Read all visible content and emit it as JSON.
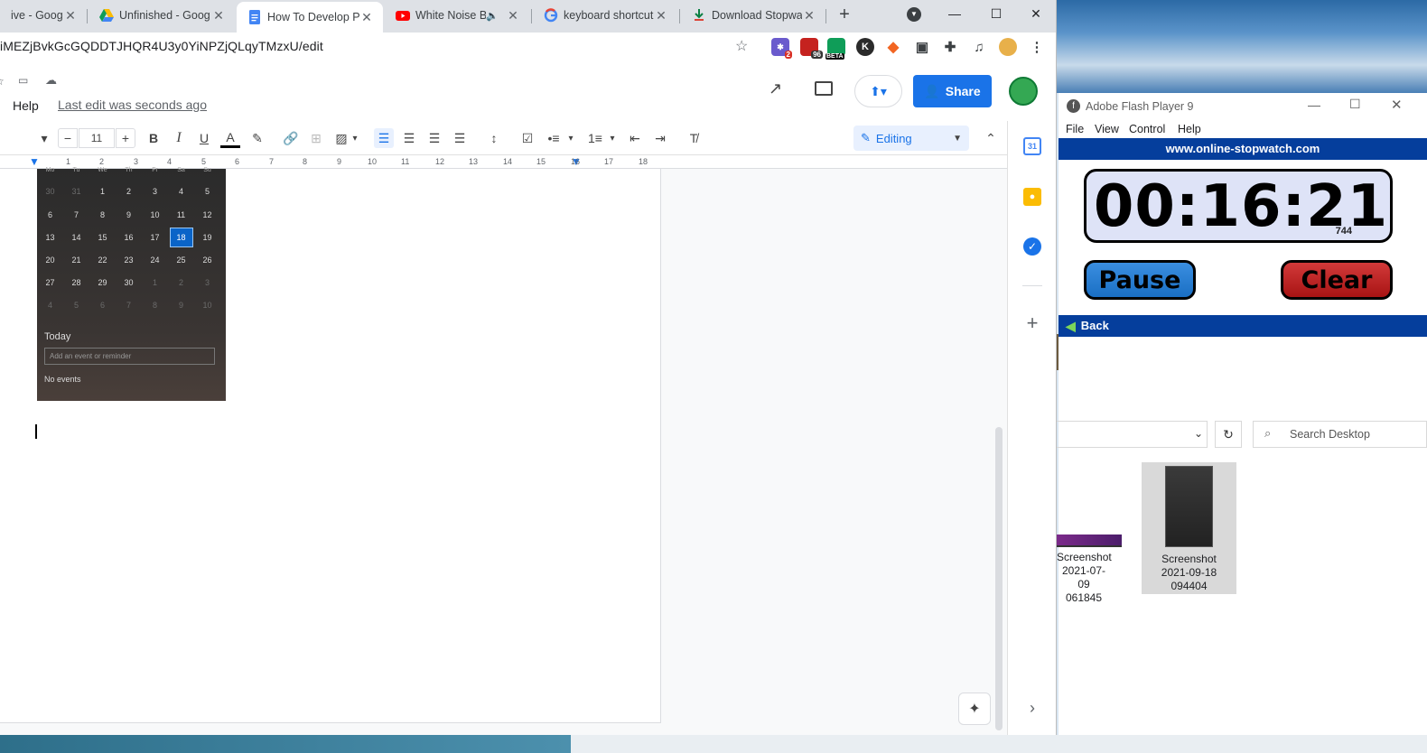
{
  "browser": {
    "tabs": [
      {
        "title": "ive - Google",
        "icon": "drive-icon"
      },
      {
        "title": "Unfinished - Goog",
        "icon": "drive-icon"
      },
      {
        "title": "How To Develop P",
        "icon": "docs-icon"
      },
      {
        "title": "White Noise B",
        "icon": "youtube-icon"
      },
      {
        "title": "keyboard shortcut",
        "icon": "google-icon"
      },
      {
        "title": "Download Stopwa",
        "icon": "download-icon"
      }
    ],
    "url": "iMEZjBvkGcGQDDTJHQR4U3y0YiNPZjQLqyTMzxU/edit",
    "ext_badges": {
      "ext1": "2",
      "ext2": "96",
      "ext3": "BETA",
      "ext4": "K"
    }
  },
  "docs": {
    "menu_help": "Help",
    "last_edit": "Last edit was seconds ago",
    "share_label": "Share",
    "font_size": "11",
    "mode_label": "Editing",
    "ruler_ticks": [
      "1",
      "2",
      "3",
      "4",
      "5",
      "6",
      "7",
      "8",
      "9",
      "10",
      "11",
      "12",
      "13",
      "14",
      "15",
      "16",
      "17",
      "18"
    ]
  },
  "calendar": {
    "weekdays": [
      "Mo",
      "Tu",
      "We",
      "Th",
      "Fr",
      "Sa",
      "Su"
    ],
    "weeks": [
      [
        "30",
        "31",
        "1",
        "2",
        "3",
        "4",
        "5"
      ],
      [
        "6",
        "7",
        "8",
        "9",
        "10",
        "11",
        "12"
      ],
      [
        "13",
        "14",
        "15",
        "16",
        "17",
        "18",
        "19"
      ],
      [
        "20",
        "21",
        "22",
        "23",
        "24",
        "25",
        "26"
      ],
      [
        "27",
        "28",
        "29",
        "30",
        "1",
        "2",
        "3"
      ],
      [
        "4",
        "5",
        "6",
        "7",
        "8",
        "9",
        "10"
      ]
    ],
    "selected_day": "18",
    "today_label": "Today",
    "event_placeholder": "Add an event or reminder",
    "no_events": "No events"
  },
  "flash": {
    "title": "Adobe Flash Player 9",
    "menu": [
      "File",
      "View",
      "Control",
      "Help"
    ],
    "site": "www.online-stopwatch.com",
    "time": "00:16:21",
    "ms": "744",
    "pause": "Pause",
    "clear": "Clear",
    "back": "Back",
    "colors": {
      "bar": "#053e9c",
      "pause": "#1a6fc4",
      "clear": "#b01818"
    }
  },
  "explorer": {
    "search_placeholder": "Search Desktop",
    "files": [
      {
        "line1": "Screenshot",
        "line2": "2021-07-09",
        "line3": "061845"
      },
      {
        "line1": "Screenshot",
        "line2": "2021-09-18",
        "line3": "094404"
      }
    ]
  }
}
